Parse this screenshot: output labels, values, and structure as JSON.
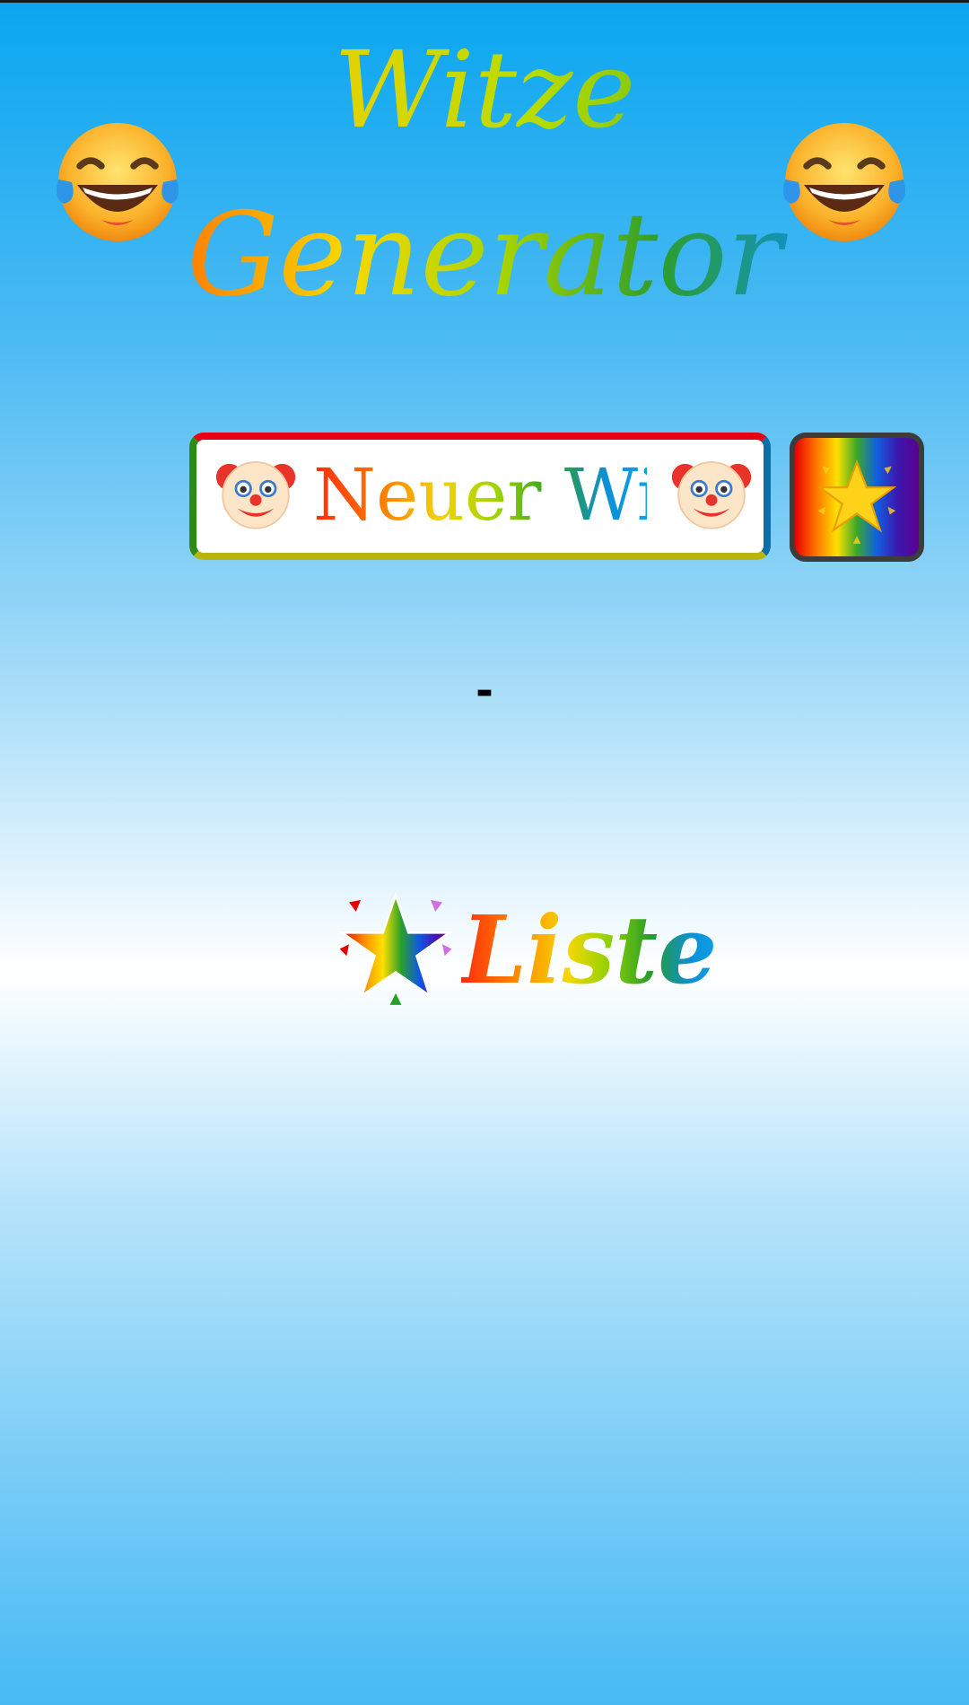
{
  "header": {
    "title_line1": "Witze",
    "title_line2": "Generator",
    "left_emoji": "face-with-tears-of-joy-icon",
    "right_emoji": "face-with-tears-of-joy-icon"
  },
  "actions": {
    "new_joke_label": "Neuer Witz",
    "new_joke_icon": "clown-face-icon",
    "favorite_icon": "glowing-star-icon"
  },
  "joke": {
    "text": "-"
  },
  "list": {
    "label": "Liste",
    "icon": "rainbow-star-icon"
  },
  "colors": {
    "background_top": "#0aa6f0",
    "background_middle": "#ffffff",
    "background_bottom": "#47baf4",
    "button_border_top": "#e60012",
    "button_border_left": "#2f8a12",
    "button_border_right": "#0d6fa8",
    "button_border_bottom": "#b9b40e"
  }
}
